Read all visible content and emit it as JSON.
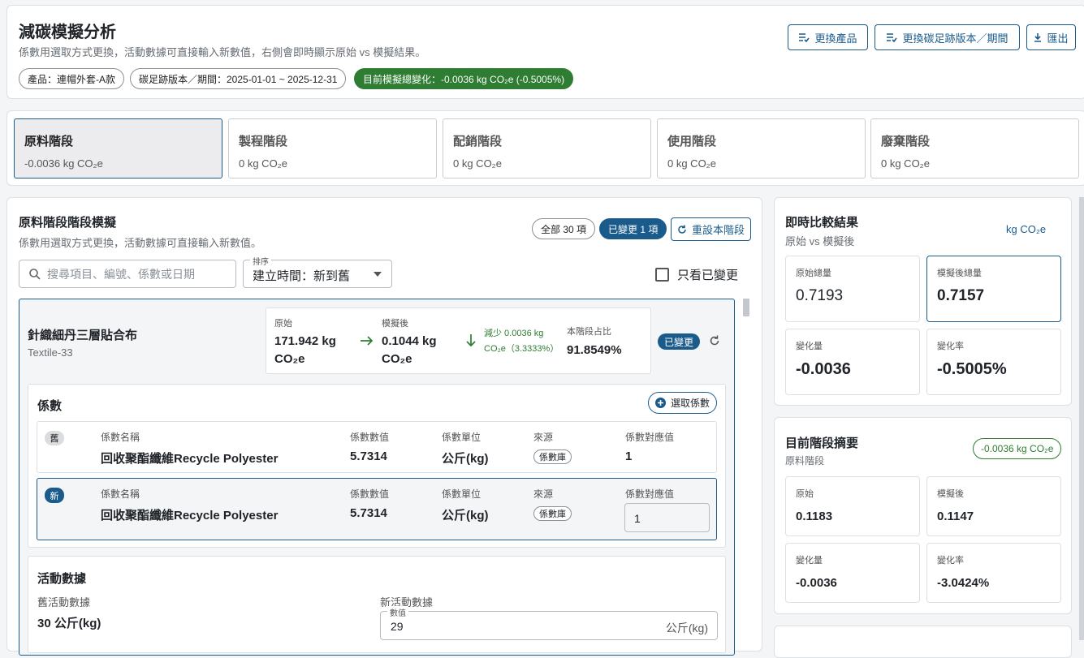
{
  "header": {
    "title": "減碳模擬分析",
    "subtitle": "係數用選取方式更換，活動數據可直接輸入新數值，右側會即時顯示原始 vs 模擬結果。",
    "chip_product": "產品：連帽外套-A款",
    "chip_version": "碳足跡版本／期間：2025-01-01 ~ 2025-12-31",
    "chip_total": "目前模擬總變化：-0.0036 kg CO₂e (-0.5005%)",
    "btn_change_product": "更換產品",
    "btn_change_version": "更換碳足跡版本／期間",
    "btn_export": "匯出"
  },
  "stages": [
    {
      "name": "原料階段",
      "value": "-0.0036 kg CO₂e"
    },
    {
      "name": "製程階段",
      "value": "0 kg CO₂e"
    },
    {
      "name": "配銷階段",
      "value": "0 kg CO₂e"
    },
    {
      "name": "使用階段",
      "value": "0 kg CO₂e"
    },
    {
      "name": "廢棄階段",
      "value": "0 kg CO₂e"
    }
  ],
  "sim": {
    "title": "原料階段階段模擬",
    "subtitle": "係數用選取方式更換，活動數據可直接輸入新數值。",
    "chip_all": "全部 30 項",
    "chip_changed": "已變更 1 項",
    "btn_reset": "重設本階段",
    "search_placeholder": "搜尋項目、編號、係數或日期",
    "sort_label": "排序",
    "sort_value": "建立時間：新到舊",
    "only_changed": "只看已變更"
  },
  "item": {
    "name": "針織細丹三層貼合布",
    "code": "Textile-33",
    "orig_label": "原始",
    "orig_value": "171.942 kg CO₂e",
    "sim_label": "模擬後",
    "sim_value": "0.1044 kg CO₂e",
    "decrease": "減少 0.0036 kg CO₂e（3.3333%）",
    "share_label": "本階段占比",
    "share_value": "91.8549%",
    "changed_badge": "已變更"
  },
  "coef": {
    "title": "係數",
    "btn_select": "選取係數",
    "headers": [
      "係數名稱",
      "係數數值",
      "係數單位",
      "來源",
      "係數對應值"
    ],
    "old_badge": "舊",
    "new_badge": "新",
    "old_row": {
      "name": "回收聚酯纖維Recycle Polyester",
      "value": "5.7314",
      "unit": "公斤(kg)",
      "source": "係數庫",
      "map": "1"
    },
    "new_row": {
      "name": "回收聚酯纖維Recycle Polyester",
      "value": "5.7314",
      "unit": "公斤(kg)",
      "source": "係數庫",
      "map": "1"
    }
  },
  "activity": {
    "title": "活動數據",
    "old_label": "舊活動數據",
    "old_value": "30 公斤(kg)",
    "new_label": "新活動數據",
    "input_label": "數值",
    "input_value": "29",
    "input_unit": "公斤(kg)"
  },
  "compare": {
    "title": "即時比較結果",
    "subtitle": "原始 vs 模擬後",
    "unit": "kg CO₂e",
    "orig_label": "原始總量",
    "orig_value": "0.7193",
    "sim_label": "模擬後總量",
    "sim_value": "0.7157",
    "diff_label": "變化量",
    "diff_value": "-0.0036",
    "rate_label": "變化率",
    "rate_value": "-0.5005%"
  },
  "summary": {
    "title": "目前階段摘要",
    "subtitle": "原料階段",
    "badge": "-0.0036 kg CO₂e",
    "orig_label": "原始",
    "orig_value": "0.1183",
    "sim_label": "模擬後",
    "sim_value": "0.1147",
    "diff_label": "變化量",
    "diff_value": "-0.0036",
    "rate_label": "變化率",
    "rate_value": "-3.0424%"
  },
  "colors": {
    "primary": "#1a5b8c",
    "success": "#2e7d32",
    "border": "#dcdfe4"
  }
}
